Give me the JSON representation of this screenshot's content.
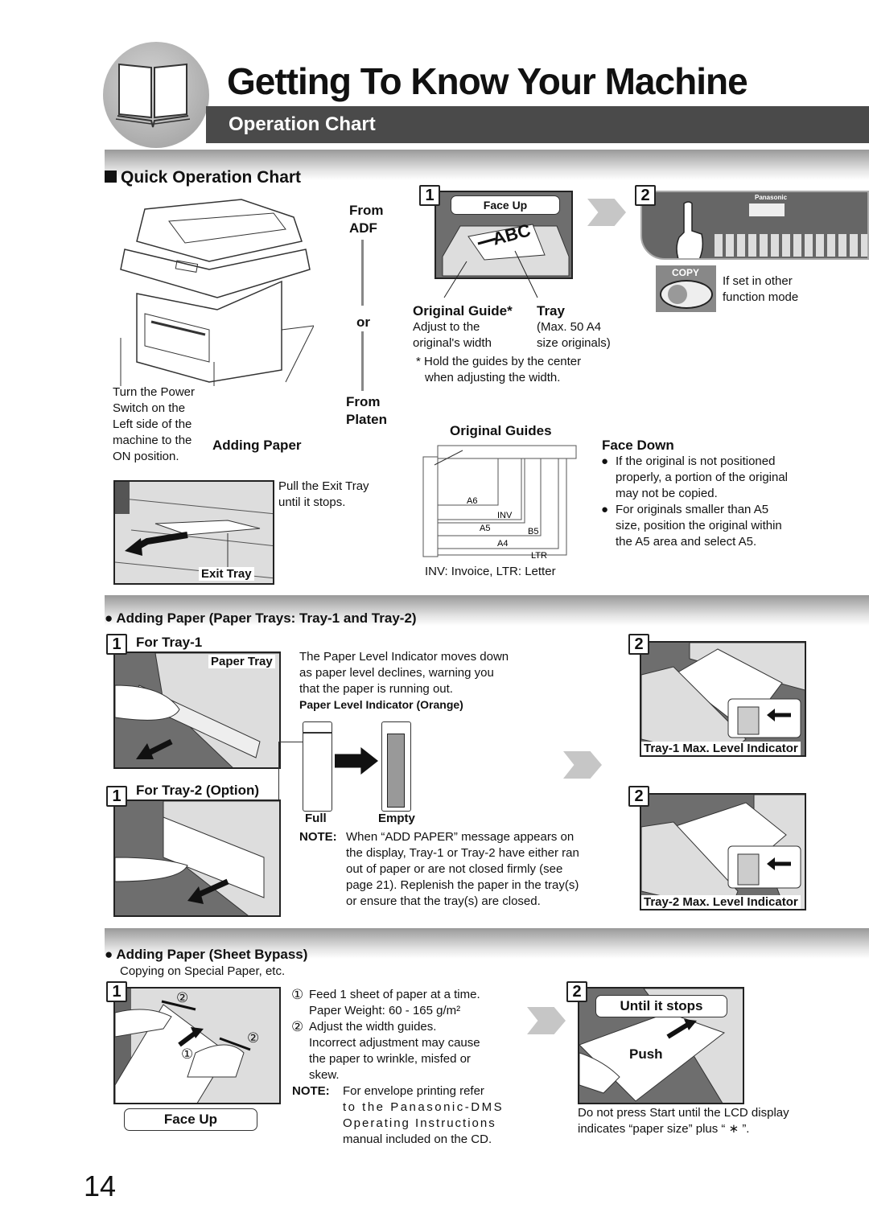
{
  "header": {
    "title": "Getting To Know Your Machine",
    "subtitle": "Operation Chart",
    "icon": "open-book-icon"
  },
  "quick": {
    "heading": "Quick Operation Chart",
    "from_adf": [
      "From",
      "ADF"
    ],
    "or": "or",
    "from_platen": [
      "From",
      "Platen"
    ],
    "power_note": [
      "Turn the Power",
      "Switch on the",
      "Left side of the",
      "machine to the",
      "ON position."
    ],
    "adding_paper": "Adding Paper",
    "exit_tray_note": [
      "Pull the Exit Tray",
      "until it stops."
    ],
    "exit_tray_caption": "Exit Tray",
    "step1": {
      "number": "1",
      "face_up": "Face Up",
      "paper_text": "ABC",
      "guide_title": "Original Guide",
      "guide_star": "*",
      "guide_lines": [
        "Adjust to the",
        "original's width"
      ],
      "tray_title": "Tray",
      "tray_lines": [
        "(Max. 50 A4",
        "size originals)"
      ],
      "hold_note": [
        "* Hold the guides by the center",
        "when adjusting the width."
      ]
    },
    "step2": {
      "number": "2",
      "brand": "Panasonic",
      "copy_label": "COPY",
      "copy_note": [
        "If set in other",
        "function mode"
      ]
    },
    "original_guides": {
      "title": "Original Guides",
      "top_labels": [
        "INV",
        "A6",
        "A5",
        "INV",
        "B5",
        "LTR",
        "A4"
      ],
      "side_labels": [
        "A6",
        "INV",
        "A5",
        "B5",
        "A4",
        "LTR"
      ],
      "area_labels": [
        "A6",
        "INV",
        "A5",
        "B5",
        "A4",
        "LTR"
      ],
      "legend": "INV: Invoice, LTR: Letter"
    },
    "face_down": {
      "title": "Face Down",
      "bullets": [
        [
          "If the original is not positioned",
          "properly, a portion of the original",
          "may not be copied."
        ],
        [
          "For originals smaller than A5",
          "size, position the original within",
          "the A5 area and select A5."
        ]
      ]
    }
  },
  "trays": {
    "heading": "Adding Paper (Paper Trays: Tray-1 and Tray-2)",
    "tray1": {
      "number": "1",
      "label": "For Tray-1",
      "caption": "Paper Tray"
    },
    "tray2": {
      "number": "1",
      "label": "For Tray-2 (Option)"
    },
    "indicator_text": [
      "The Paper Level Indicator moves down",
      "as paper level declines, warning you",
      "that the paper is running out."
    ],
    "indicator_title": "Paper Level Indicator (Orange)",
    "full_label": "Full",
    "empty_label": "Empty",
    "note_label": "NOTE:",
    "note_lines": [
      "When “ADD PAPER” message appears on",
      "the display, Tray-1 or Tray-2 have either ran",
      "out of paper or are not closed firmly (see",
      "page 21). Replenish the paper in the tray(s)",
      "or ensure that the tray(s) are closed."
    ],
    "tray1_max": {
      "number": "2",
      "caption": "Tray-1 Max. Level Indicator"
    },
    "tray2_max": {
      "number": "2",
      "caption": "Tray-2 Max. Level Indicator"
    }
  },
  "bypass": {
    "heading": "Adding Paper (Sheet Bypass)",
    "subheading": "Copying on Special Paper, etc.",
    "step1": {
      "number": "1",
      "face_up": "Face Up",
      "mark1": "①",
      "mark2": "②"
    },
    "items": [
      {
        "mark": "①",
        "lines": [
          "Feed 1 sheet of paper at a time.",
          "Paper Weight: 60 - 165 g/m²"
        ]
      },
      {
        "mark": "②",
        "lines": [
          "Adjust the width guides.",
          "Incorrect adjustment may cause",
          "the paper to wrinkle, misfed or",
          "skew."
        ]
      }
    ],
    "note_label": "NOTE:",
    "note_lines": [
      "For envelope printing refer",
      "to the Panasonic-DMS",
      "Operating Instructions",
      "manual included on the CD."
    ],
    "step2": {
      "number": "2",
      "until": "Until it stops",
      "push": "Push"
    },
    "start_note": [
      "Do not press Start until the LCD display",
      "indicates “paper size” plus “ ∗ ”."
    ]
  },
  "page_number": "14"
}
